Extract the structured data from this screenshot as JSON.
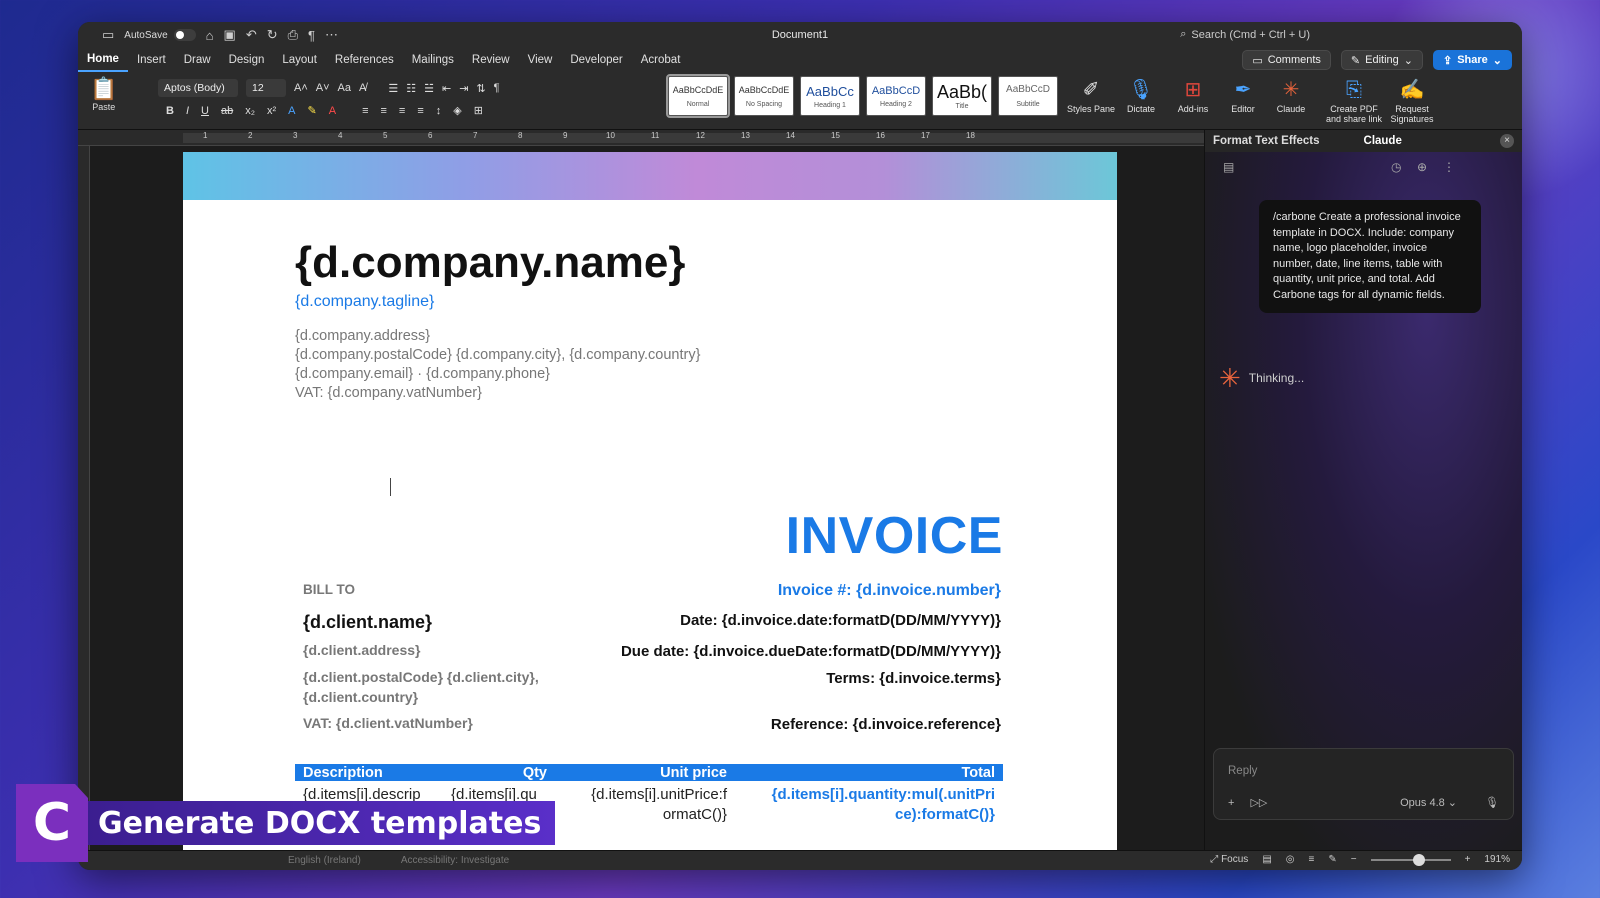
{
  "titlebar": {
    "autosave": "AutoSave",
    "doc_title": "Document1",
    "search": "Search (Cmd + Ctrl + U)"
  },
  "tabs": [
    "Home",
    "Insert",
    "Draw",
    "Design",
    "Layout",
    "References",
    "Mailings",
    "Review",
    "View",
    "Developer",
    "Acrobat"
  ],
  "actions": {
    "comments": "Comments",
    "editing": "Editing",
    "share": "Share"
  },
  "ribbon": {
    "paste": "Paste",
    "font": "Aptos (Body)",
    "size": "12",
    "styles": [
      {
        "preview": "AaBbCcDdE",
        "label": "Normal"
      },
      {
        "preview": "AaBbCcDdE",
        "label": "No Spacing"
      },
      {
        "preview": "AaBbCc",
        "label": "Heading 1"
      },
      {
        "preview": "AaBbCcD",
        "label": "Heading 2"
      },
      {
        "preview": "AaBb(",
        "label": "Title"
      },
      {
        "preview": "AaBbCcD",
        "label": "Subtitle"
      }
    ],
    "styles_pane": "Styles Pane",
    "dictate": "Dictate",
    "addins": "Add-ins",
    "editor": "Editor",
    "claude": "Claude",
    "create_pdf": "Create PDF and share link",
    "request_sig": "Request Signatures"
  },
  "ruler": [
    "1",
    "2",
    "3",
    "4",
    "5",
    "6",
    "7",
    "8",
    "9",
    "10",
    "11",
    "12",
    "13",
    "14",
    "15",
    "16",
    "17",
    "18"
  ],
  "document": {
    "company_name": "{d.company.name}",
    "tagline": "{d.company.tagline}",
    "address": [
      "{d.company.address}",
      "{d.company.postalCode} {d.company.city}, {d.company.country}",
      "{d.company.email} · {d.company.phone}",
      "VAT: {d.company.vatNumber}"
    ],
    "invoice_title": "INVOICE",
    "bill_to": "BILL TO",
    "client_name": "{d.client.name}",
    "client_address": "{d.client.address}",
    "client_city_1": "{d.client.postalCode} {d.client.city},",
    "client_city_2": "{d.client.country}",
    "client_vat": "VAT: {d.client.vatNumber}",
    "invoice_number": "Invoice #:  {d.invoice.number}",
    "date": "Date:  {d.invoice.date:formatD(DD/MM/YYYY)}",
    "due_date": "Due date:  {d.invoice.dueDate:formatD(DD/MM/YYYY)}",
    "terms": "Terms:  {d.invoice.terms}",
    "reference": "Reference:  {d.invoice.reference}",
    "table": {
      "headers": [
        "Description",
        "Qty",
        "Unit price",
        "Total"
      ],
      "row": [
        "{d.items[i].descrip tion}",
        "{d.items[i].qu antity}",
        "{d.items[i].unitPrice:f ormatC()}",
        "{d.items[i].quantity:mul(.unitPri ce):formatC()}"
      ]
    }
  },
  "panel": {
    "tab_effects": "Format Text Effects",
    "tab_claude": "Claude",
    "message": "/carbone Create a professional invoice template in DOCX. Include: company name, logo placeholder, invoice number, date, line items, table with quantity, unit price, and total. Add Carbone tags for all dynamic fields.",
    "thinking": "Thinking...",
    "reply_placeholder": "Reply",
    "model": "Opus 4.8"
  },
  "statusbar": {
    "language": "English (Ireland)",
    "accessibility": "Accessibility: Investigate",
    "focus": "Focus",
    "zoom": "191%"
  },
  "brand": {
    "logo": "C",
    "label": "Generate DOCX templates"
  }
}
